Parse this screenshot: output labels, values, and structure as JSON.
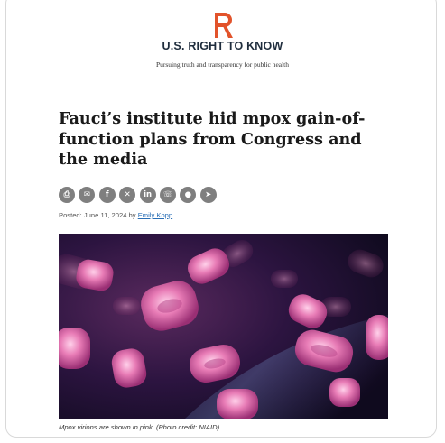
{
  "header": {
    "logo_icon": "usrtk-r-logo",
    "logo_color": "#e2532b",
    "site_name": "U.S. RIGHT TO KNOW",
    "tagline": "Pursuing truth and transparency for public health"
  },
  "article": {
    "title": "Fauci’s institute hid mpox gain-of-function plans from Congress and the media",
    "share_icons": [
      {
        "name": "print-icon",
        "glyph": "⎙"
      },
      {
        "name": "email-icon",
        "glyph": "✉"
      },
      {
        "name": "facebook-icon",
        "glyph": "f"
      },
      {
        "name": "x-twitter-icon",
        "glyph": "✕"
      },
      {
        "name": "linkedin-icon",
        "glyph": "in"
      },
      {
        "name": "whatsapp-icon",
        "glyph": "☏"
      },
      {
        "name": "reddit-icon",
        "glyph": "●"
      },
      {
        "name": "telegram-icon",
        "glyph": "➤"
      }
    ],
    "posted_prefix": "Posted: June 11, 2024 by",
    "author": "Emily Kopp",
    "image_caption": "Mpox virions are shown in pink. (Photo credit: NIAID)"
  }
}
